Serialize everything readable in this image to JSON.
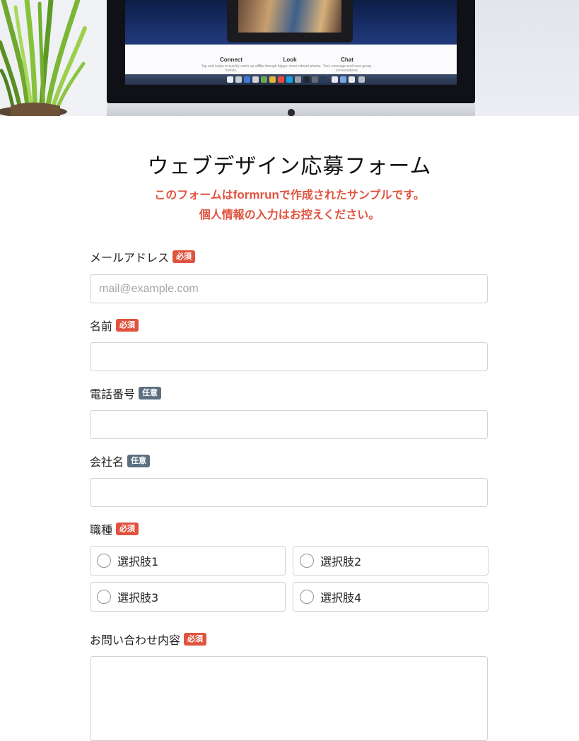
{
  "form": {
    "title": "ウェブデザイン応募フォーム",
    "notice_prefix": "このフォームは",
    "notice_brand": "formrun",
    "notice_suffix": "で作成されたサンプルです。",
    "notice_line2": "個人情報の入力はお控えください。"
  },
  "badges": {
    "required": "必須",
    "optional": "任意"
  },
  "fields": {
    "email": {
      "label": "メールアドレス",
      "placeholder": "mail@example.com",
      "value": ""
    },
    "name": {
      "label": "名前",
      "value": ""
    },
    "phone": {
      "label": "電話番号",
      "value": ""
    },
    "company": {
      "label": "会社名",
      "value": ""
    },
    "job_type": {
      "label": "職種",
      "options": [
        "選択肢1",
        "選択肢2",
        "選択肢3",
        "選択肢4"
      ]
    },
    "inquiry": {
      "label": "お問い合わせ内容",
      "value": ""
    }
  },
  "hero": {
    "screen_features": [
      {
        "title": "Connect",
        "desc": "Tap and swipe to quickly catch up with friends."
      },
      {
        "title": "Look",
        "desc": "Flip through bigger, more vibrant photos."
      },
      {
        "title": "Chat",
        "desc": "Text, message and have group conversations."
      }
    ]
  },
  "colors": {
    "accent_red": "#e0533f",
    "optional_badge": "#5c6f82",
    "input_border": "#cfd2d6"
  }
}
